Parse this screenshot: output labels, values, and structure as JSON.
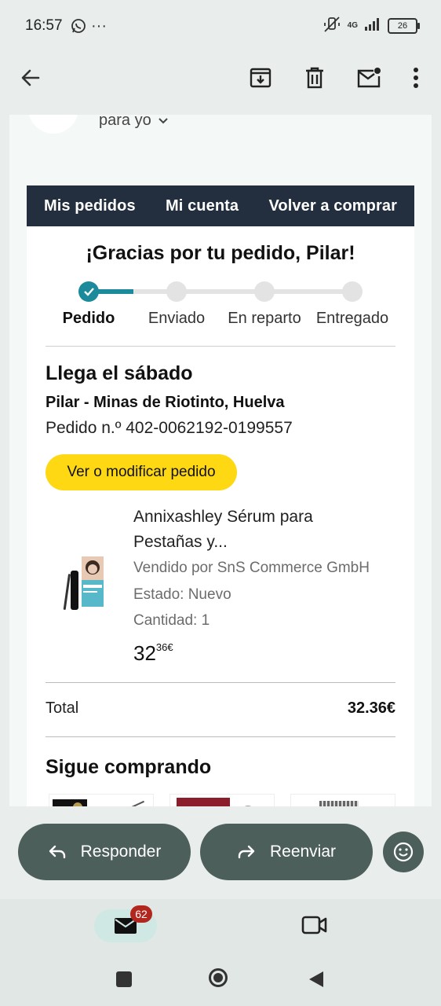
{
  "status_bar": {
    "time": "16:57",
    "battery": "26",
    "network": "4G"
  },
  "email_header": {
    "recipient": "para yo"
  },
  "email_nav": {
    "links": [
      "Mis pedidos",
      "Mi cuenta",
      "Volver a comprar"
    ]
  },
  "order": {
    "greeting": "¡Gracias por tu pedido, Pilar!",
    "steps": [
      "Pedido",
      "Enviado",
      "En reparto",
      "Entregado"
    ],
    "arrival": "Llega el sábado",
    "address": "Pilar - Minas de Riotinto, Huelva",
    "order_number": "Pedido n.º 402-0062192-0199557",
    "modify_button": "Ver o modificar pedido",
    "product": {
      "title_line1": "Annixashley Sérum para",
      "title_line2": "Pestañas y...",
      "seller": "Vendido por SnS Commerce GmbH",
      "condition": "Estado: Nuevo",
      "quantity": "Cantidad: 1",
      "price_whole": "32",
      "price_fraction": "36€"
    },
    "total_label": "Total",
    "total_value": "32.36€",
    "keep_shopping": "Sigue comprando"
  },
  "actions": {
    "reply": "Responder",
    "forward": "Reenviar"
  },
  "bottom_nav": {
    "mail_badge": "62"
  }
}
